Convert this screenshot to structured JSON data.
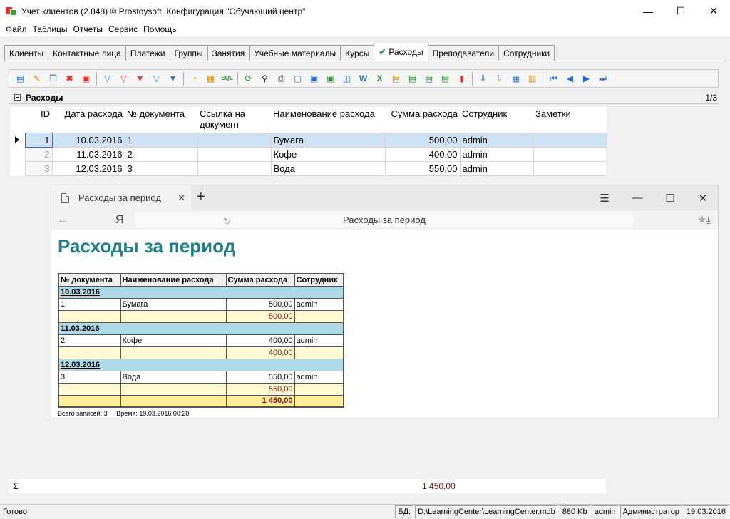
{
  "window": {
    "title": "Учет клиентов (2.848) © Prostoysoft. Конфигурация \"Обучающий центр\"",
    "min": "—",
    "max": "☐",
    "close": "✕"
  },
  "menu": [
    "Файл",
    "Таблицы",
    "Отчеты",
    "Сервис",
    "Помощь"
  ],
  "tabs": [
    {
      "label": "Клиенты",
      "active": false
    },
    {
      "label": "Контактные лица",
      "active": false
    },
    {
      "label": "Платежи",
      "active": false
    },
    {
      "label": "Группы",
      "active": false
    },
    {
      "label": "Занятия",
      "active": false
    },
    {
      "label": "Учебные материалы",
      "active": false
    },
    {
      "label": "Курсы",
      "active": false
    },
    {
      "label": "Расходы",
      "active": true
    },
    {
      "label": "Преподаватели",
      "active": false
    },
    {
      "label": "Сотрудники",
      "active": false
    }
  ],
  "grid_panel": {
    "title": "Расходы",
    "count": "1/3"
  },
  "grid": {
    "columns": [
      "ID",
      "Дата расхода",
      "№ документа",
      "Ссылка на документ",
      "Наименование расхода",
      "Сумма расхода",
      "Сотрудник",
      "Заметки"
    ],
    "rows": [
      [
        "1",
        "10.03.2016",
        "1",
        "",
        "Бумага",
        "500,00",
        "admin",
        ""
      ],
      [
        "2",
        "11.03.2016",
        "2",
        "",
        "Кофе",
        "400,00",
        "admin",
        ""
      ],
      [
        "3",
        "12.03.2016",
        "3",
        "",
        "Вода",
        "550,00",
        "admin",
        ""
      ]
    ]
  },
  "browser": {
    "tab_title": "Расходы за период",
    "tab_close": "✕",
    "new_tab": "+",
    "menu_icon": "☰",
    "min": "—",
    "max": "☐",
    "close": "✕",
    "back": "←",
    "yandex": "Я",
    "reload": "↻",
    "address": "Расходы за период",
    "star": "★",
    "download": "⤓"
  },
  "report": {
    "title": "Расходы за период",
    "headers": [
      "№ документа",
      "Наименование расхода",
      "Сумма расхода",
      "Сотрудник"
    ],
    "groups": [
      {
        "date": "10.03.2016",
        "doc": "1",
        "name": "Бумага",
        "sum": "500,00",
        "emp": "admin",
        "subtotal": "500,00"
      },
      {
        "date": "11.03.2016",
        "doc": "2",
        "name": "Кофе",
        "sum": "400,00",
        "emp": "admin",
        "subtotal": "400,00"
      },
      {
        "date": "12.03.2016",
        "doc": "3",
        "name": "Вода",
        "sum": "550,00",
        "emp": "admin",
        "subtotal": "550,00"
      }
    ],
    "total": "1 450,00",
    "footer_records_label": "Всего записей:",
    "footer_records": "3",
    "footer_time_label": "Время:",
    "footer_time": "19.03.2016 00:20"
  },
  "sum_row": {
    "sigma": "Σ",
    "value": "1 450,00"
  },
  "status": {
    "ready": "Готово",
    "db": "БД:",
    "db_path": "D:\\LearningCenter\\LearningCenter.mdb",
    "mem": "880 Kb",
    "user": "admin",
    "role": "Администратор",
    "date": "19.03.2016"
  },
  "toolbar_icons": [
    "new-record-icon",
    "edit-icon",
    "copy-record-icon",
    "delete-icon",
    "delete-all-icon",
    "filter-icon",
    "filter-clear-icon",
    "filter-remove-icon",
    "filter-alt-icon",
    "filter-edit-icon",
    "search-filter-icon",
    "group-filter-icon",
    "sql-icon",
    "refresh-icon",
    "find-icon",
    "print-icon",
    "preview-icon",
    "export-icon",
    "export-alt-icon",
    "export-html-icon",
    "export-word-icon",
    "export-excel-icon",
    "export-xml-icon",
    "export-csv-icon",
    "export-txt-icon",
    "export-db-icon",
    "chart-icon",
    "import-icon",
    "import-alt-icon",
    "table-settings-icon",
    "columns-icon",
    "first-record-icon",
    "prev-record-icon",
    "next-record-icon",
    "last-record-icon"
  ]
}
